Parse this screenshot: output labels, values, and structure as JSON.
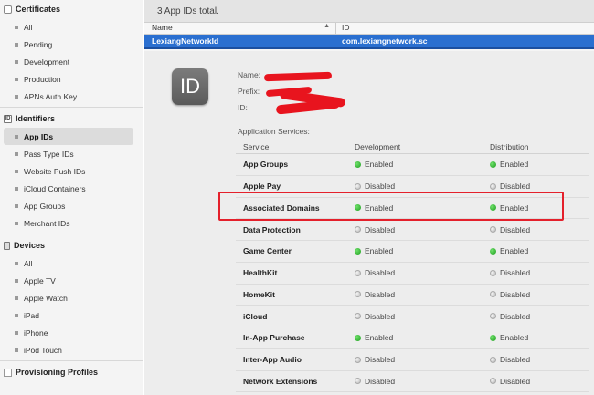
{
  "sidebar": {
    "certificates": {
      "title": "Certificates",
      "items": [
        "All",
        "Pending",
        "Development",
        "Production",
        "APNs Auth Key"
      ]
    },
    "identifiers": {
      "title": "Identifiers",
      "items": [
        "App IDs",
        "Pass Type IDs",
        "Website Push IDs",
        "iCloud Containers",
        "App Groups",
        "Merchant IDs"
      ],
      "active": "App IDs"
    },
    "devices": {
      "title": "Devices",
      "items": [
        "All",
        "Apple TV",
        "Apple Watch",
        "iPad",
        "iPhone",
        "iPod Touch"
      ]
    },
    "provisioning": {
      "title": "Provisioning Profiles"
    }
  },
  "main": {
    "count_text": "3  App IDs total.",
    "columns": {
      "name": "Name",
      "id": "ID",
      "sort_glyph": "▲"
    },
    "selected_row": {
      "name": "LexiangNetworkId",
      "id": "com.lexiangnetwork.sc"
    },
    "detail": {
      "icon_text": "ID",
      "name_label": "Name:",
      "prefix_label": "Prefix:",
      "id_label": "ID:",
      "services_title": "Application Services:",
      "headers": {
        "service": "Service",
        "development": "Development",
        "distribution": "Distribution"
      },
      "services": [
        {
          "name": "App Groups",
          "dev": "Enabled",
          "dev_on": true,
          "dist": "Enabled",
          "dist_on": true
        },
        {
          "name": "Apple Pay",
          "dev": "Disabled",
          "dev_on": false,
          "dist": "Disabled",
          "dist_on": false
        },
        {
          "name": "Associated Domains",
          "dev": "Enabled",
          "dev_on": true,
          "dist": "Enabled",
          "dist_on": true
        },
        {
          "name": "Data Protection",
          "dev": "Disabled",
          "dev_on": false,
          "dist": "Disabled",
          "dist_on": false
        },
        {
          "name": "Game Center",
          "dev": "Enabled",
          "dev_on": true,
          "dist": "Enabled",
          "dist_on": true
        },
        {
          "name": "HealthKit",
          "dev": "Disabled",
          "dev_on": false,
          "dist": "Disabled",
          "dist_on": false
        },
        {
          "name": "HomeKit",
          "dev": "Disabled",
          "dev_on": false,
          "dist": "Disabled",
          "dist_on": false
        },
        {
          "name": "iCloud",
          "dev": "Disabled",
          "dev_on": false,
          "dist": "Disabled",
          "dist_on": false
        },
        {
          "name": "In-App Purchase",
          "dev": "Enabled",
          "dev_on": true,
          "dist": "Enabled",
          "dist_on": true
        },
        {
          "name": "Inter-App Audio",
          "dev": "Disabled",
          "dev_on": false,
          "dist": "Disabled",
          "dist_on": false
        },
        {
          "name": "Network Extensions",
          "dev": "Disabled",
          "dev_on": false,
          "dist": "Disabled",
          "dist_on": false
        }
      ]
    }
  },
  "colors": {
    "selection": "#2a6fd0",
    "highlight": "#e4202b",
    "enabled": "#1f9e1f"
  }
}
